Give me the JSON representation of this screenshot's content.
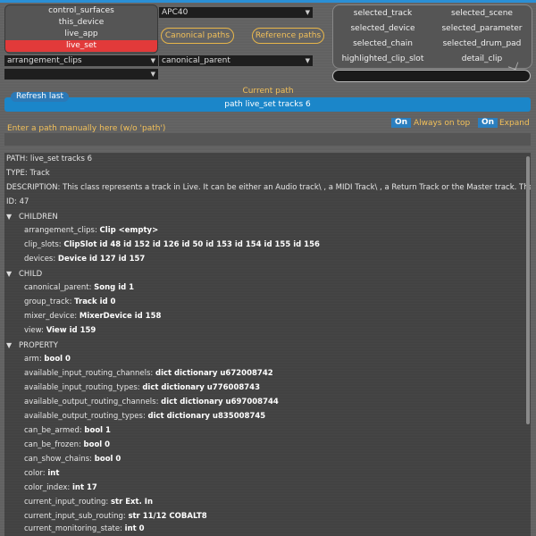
{
  "canonical_list": {
    "items": [
      "control_surfaces",
      "this_device",
      "live_app",
      "live_set"
    ],
    "selected_index": 3
  },
  "dropdowns": {
    "surface": "APC40",
    "left_child": "arrangement_clips",
    "canonical_parent": "canonical_parent",
    "empty": ""
  },
  "bubbles": {
    "canonical": "Canonical paths",
    "reference": "Reference paths"
  },
  "reference_list": {
    "items": [
      "selected_track",
      "selected_scene",
      "selected_device",
      "selected_parameter",
      "selected_chain",
      "selected_drum_pad",
      "highlighted_clip_slot",
      "detail_clip"
    ]
  },
  "refresh_button": "Refresh last",
  "current_path_label": "Current path",
  "current_path": "path live_set tracks 6",
  "manual_hint": "Enter a path manually here (w/o 'path')",
  "toggles": {
    "always_on_top_state": "On",
    "always_on_top_label": "Always on top",
    "expand_state": "On",
    "expand_label": "Expand"
  },
  "info": {
    "path_line": "PATH: live_set tracks 6",
    "type_line": "TYPE: Track",
    "description_line": "DESCRIPTION: This class represents a track in Live. It can be either an Audio track\\ , a MIDI Track\\ , a Return Track or the Master track. The Master Tra...",
    "id_line": "ID: 47"
  },
  "sections": [
    {
      "title": "CHILDREN",
      "rows": [
        {
          "key": "arrangement_clips:",
          "value": "Clip <empty>"
        },
        {
          "key": "clip_slots:",
          "value": "ClipSlot id 48 id 152 id 126 id 50 id 153 id 154 id 155 id 156"
        },
        {
          "key": "devices:",
          "value": "Device id 127 id 157"
        }
      ]
    },
    {
      "title": "CHILD",
      "rows": [
        {
          "key": "canonical_parent:",
          "value": "Song id 1"
        },
        {
          "key": "group_track:",
          "value": "Track id 0"
        },
        {
          "key": "mixer_device:",
          "value": "MixerDevice id 158"
        },
        {
          "key": "view:",
          "value": "View id 159"
        }
      ]
    },
    {
      "title": "PROPERTY",
      "rows": [
        {
          "key": "arm:",
          "value": "bool 0"
        },
        {
          "key": "available_input_routing_channels:",
          "value": "dict dictionary u672008742"
        },
        {
          "key": "available_input_routing_types:",
          "value": "dict dictionary u776008743"
        },
        {
          "key": "available_output_routing_channels:",
          "value": "dict dictionary u697008744"
        },
        {
          "key": "available_output_routing_types:",
          "value": "dict dictionary u835008745"
        },
        {
          "key": "can_be_armed:",
          "value": "bool 1"
        },
        {
          "key": "can_be_frozen:",
          "value": "bool 0"
        },
        {
          "key": "can_show_chains:",
          "value": "bool 0"
        },
        {
          "key": "color:",
          "value": "int"
        },
        {
          "key": "color_index:",
          "value": "int 17"
        },
        {
          "key": "current_input_routing:",
          "value": "str Ext. In"
        },
        {
          "key": "current_input_sub_routing:",
          "value": "str 11/12 COBALT8"
        },
        {
          "key": "current_monitoring_state:",
          "value": "int 0"
        }
      ]
    }
  ],
  "icons": {
    "expand": "triangle-down-icon",
    "dropdown": "chevron-down-icon"
  },
  "colors": {
    "accent_blue": "#1b86c9",
    "selection_red": "#e23a3a",
    "label_yellow": "#f2c05a"
  }
}
